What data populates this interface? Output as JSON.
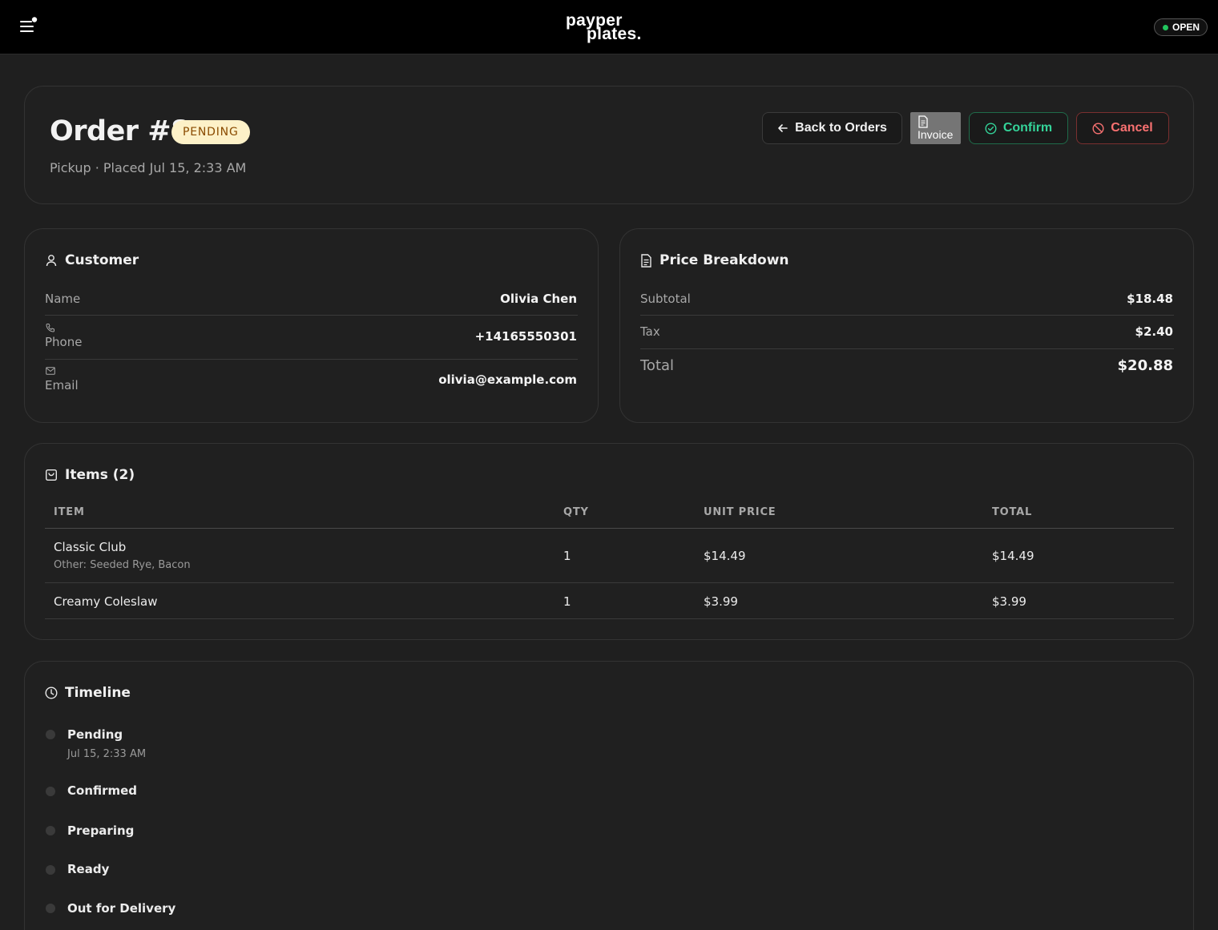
{
  "topbar": {
    "logo_line1": "payper",
    "logo_line2": "plates.",
    "status_label": "OPEN",
    "status_color": "#22c55e"
  },
  "order": {
    "title": "Order #8",
    "status": "PENDING",
    "subtitle": "Pickup · Placed Jul 15, 2:33 AM",
    "actions": {
      "back": "Back to Orders",
      "invoice": "Invoice",
      "confirm": "Confirm",
      "cancel": "Cancel"
    }
  },
  "customer": {
    "title": "Customer",
    "name_label": "Name",
    "name": "Olivia Chen",
    "phone_label": "Phone",
    "phone": "+14165550301",
    "email_label": "Email",
    "email": "olivia@example.com"
  },
  "price": {
    "title": "Price Breakdown",
    "subtotal_label": "Subtotal",
    "subtotal": "$18.48",
    "tax_label": "Tax",
    "tax": "$2.40",
    "total_label": "Total",
    "total": "$20.88"
  },
  "items": {
    "title": "Items (2)",
    "columns": [
      "ITEM",
      "QTY",
      "UNIT PRICE",
      "TOTAL"
    ],
    "rows": [
      {
        "name": "Classic Club",
        "note": "Other: Seeded Rye, Bacon",
        "qty": "1",
        "unit_price": "$14.49",
        "total": "$14.49"
      },
      {
        "name": "Creamy Coleslaw",
        "note": "",
        "qty": "1",
        "unit_price": "$3.99",
        "total": "$3.99"
      }
    ]
  },
  "timeline": {
    "title": "Timeline",
    "steps": [
      {
        "label": "Pending",
        "time": "Jul 15, 2:33 AM"
      },
      {
        "label": "Confirmed",
        "time": ""
      },
      {
        "label": "Preparing",
        "time": ""
      },
      {
        "label": "Ready",
        "time": ""
      },
      {
        "label": "Out for Delivery",
        "time": ""
      }
    ]
  },
  "colors": {
    "background": "#1f1f1f",
    "pending_badge_bg": "#fdf1c8",
    "pending_badge_text": "#8a4b00",
    "confirm": "#34d399",
    "cancel": "#f87171"
  }
}
